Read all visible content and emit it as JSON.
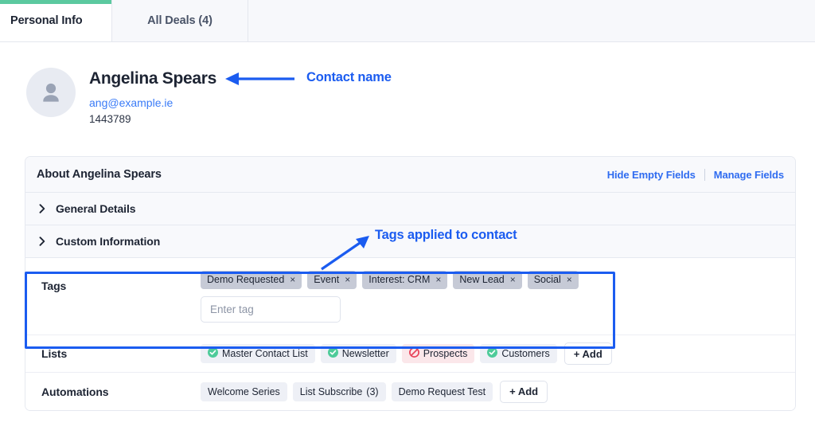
{
  "tabs": [
    {
      "label": "Personal Info",
      "active": true,
      "accent_color": "#5bc99f"
    },
    {
      "label": "All Deals (4)",
      "active": false
    }
  ],
  "contact": {
    "avatar_icon": "user-avatar-icon",
    "name": "Angelina Spears",
    "email": "ang@example.ie",
    "id": "1443789"
  },
  "about_card": {
    "title": "About Angelina Spears",
    "hide_empty_fields_label": "Hide Empty Fields",
    "manage_fields_label": "Manage Fields",
    "accordions": [
      {
        "label": "General Details",
        "icon": "chevron-right-icon"
      },
      {
        "label": "Custom Information",
        "icon": "chevron-right-icon"
      }
    ],
    "tags_row": {
      "label": "Tags",
      "tags": [
        {
          "label": "Demo Requested",
          "remove_icon": "×"
        },
        {
          "label": "Event",
          "remove_icon": "×"
        },
        {
          "label": "Interest: CRM",
          "remove_icon": "×"
        },
        {
          "label": "New Lead",
          "remove_icon": "×"
        },
        {
          "label": "Social",
          "remove_icon": "×"
        }
      ],
      "input_placeholder": "Enter tag",
      "input_value": ""
    },
    "lists_row": {
      "label": "Lists",
      "items": [
        {
          "label": "Master Contact List",
          "status": "subscribed",
          "icon": "check-circle-icon"
        },
        {
          "label": "Newsletter",
          "status": "subscribed",
          "icon": "check-circle-icon"
        },
        {
          "label": "Prospects",
          "status": "unsubscribed",
          "icon": "block-circle-icon"
        },
        {
          "label": "Customers",
          "status": "subscribed",
          "icon": "check-circle-icon"
        }
      ],
      "add_label": "+ Add"
    },
    "automations_row": {
      "label": "Automations",
      "items": [
        {
          "label": "Welcome Series",
          "count": ""
        },
        {
          "label": "List Subscribe",
          "count": "(3)"
        },
        {
          "label": "Demo Request Test",
          "count": ""
        }
      ],
      "add_label": "+ Add"
    }
  },
  "annotations": {
    "color": "#1b5cf0",
    "contact_name_note": "Contact name",
    "tags_note": "Tags applied to contact"
  }
}
